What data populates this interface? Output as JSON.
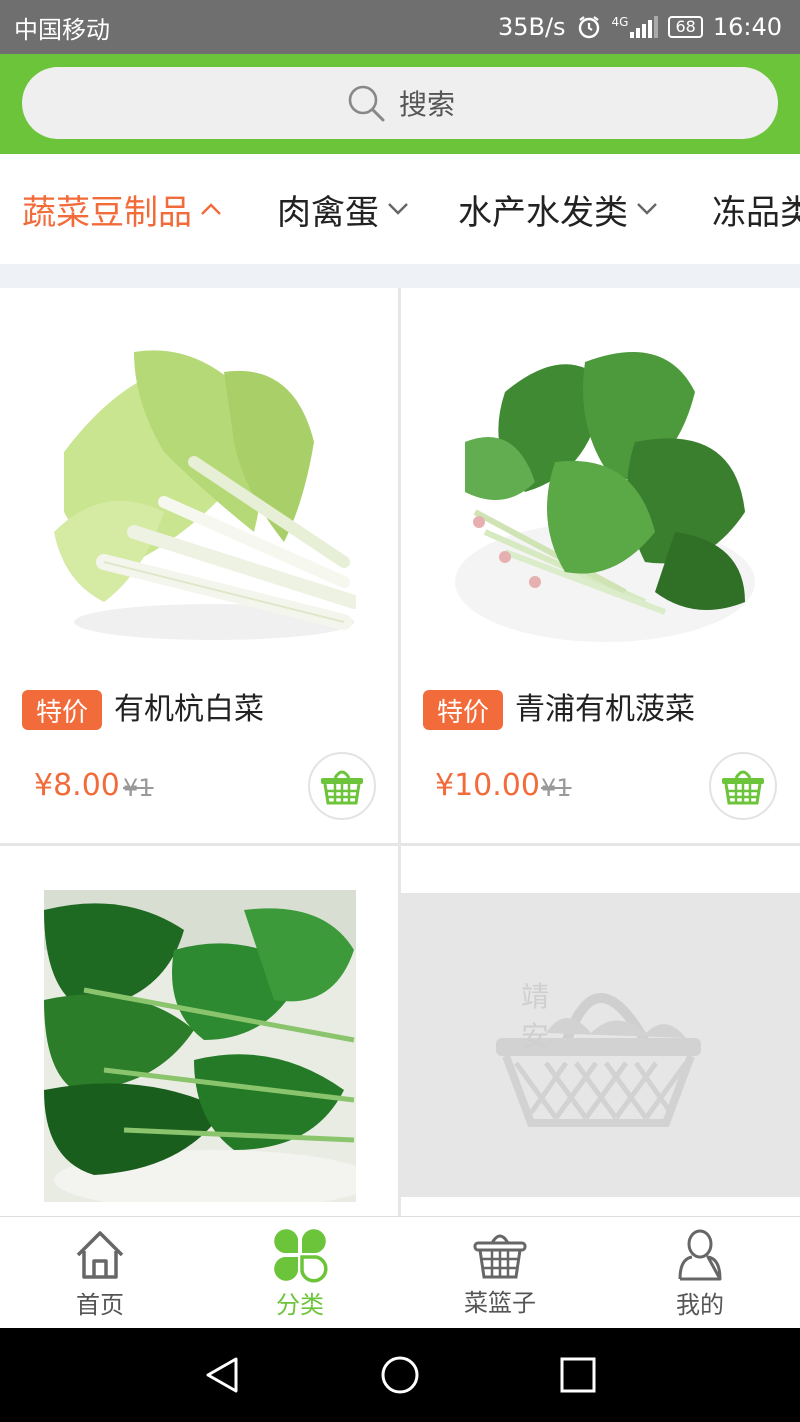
{
  "status_bar": {
    "carrier": "中国移动",
    "speed": "35B/s",
    "network": "4G",
    "battery": "68",
    "time": "16:40"
  },
  "search": {
    "placeholder": "搜索"
  },
  "category_tabs": [
    {
      "label": "蔬菜豆制品",
      "active": true
    },
    {
      "label": "肉禽蛋",
      "active": false
    },
    {
      "label": "水产水发类",
      "active": false
    },
    {
      "label": "冻品类",
      "active": false
    }
  ],
  "products": [
    {
      "badge": "特价",
      "name": "有机杭白菜",
      "price": "¥8.00",
      "old_price": "¥1"
    },
    {
      "badge": "特价",
      "name": "青浦有机菠菜",
      "price": "¥10.00",
      "old_price": "¥1"
    },
    {
      "badge": "",
      "name": "",
      "price": "",
      "old_price": ""
    },
    {
      "badge": "",
      "name": "",
      "price": "",
      "old_price": ""
    }
  ],
  "placeholder_logo": {
    "text": "靖安"
  },
  "tab_bar": [
    {
      "label": "首页",
      "icon": "home-icon",
      "active": false
    },
    {
      "label": "分类",
      "icon": "clover-icon",
      "active": true
    },
    {
      "label": "菜篮子",
      "icon": "basket-icon",
      "active": false
    },
    {
      "label": "我的",
      "icon": "user-icon",
      "active": false
    }
  ],
  "colors": {
    "accent_green": "#6cc43a",
    "accent_orange": "#f26b3a"
  }
}
